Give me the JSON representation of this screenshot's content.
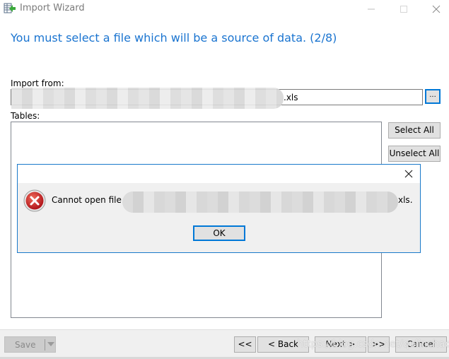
{
  "window": {
    "title": "Import Wizard",
    "icon": "import-table-icon",
    "controls": [
      "minimize-icon",
      "maximize-icon",
      "close-icon"
    ]
  },
  "wizard": {
    "heading": "You must select a file which will be a source of data. (2/8)",
    "import_from_label": "Import from:",
    "import_path_visible_suffix": ".xls",
    "browse_label": "...",
    "tables_label": "Tables:",
    "select_all_label": "Select All",
    "unselect_all_label": "Unselect All"
  },
  "dialog": {
    "icon": "error-icon",
    "message_prefix": "Cannot open file",
    "message_suffix": "xls.",
    "ok_label": "OK"
  },
  "footer": {
    "save_label": "Save",
    "first_label": "<<",
    "back_label": "< Back",
    "next_label": "Next >",
    "last_label": ">>",
    "cancel_label": "Cancel",
    "watermark": "https://blog.csdn.net/qulinchao"
  },
  "colors": {
    "accent": "#0078d7",
    "heading": "#1a74d0",
    "error_red": "#c42b1c"
  }
}
